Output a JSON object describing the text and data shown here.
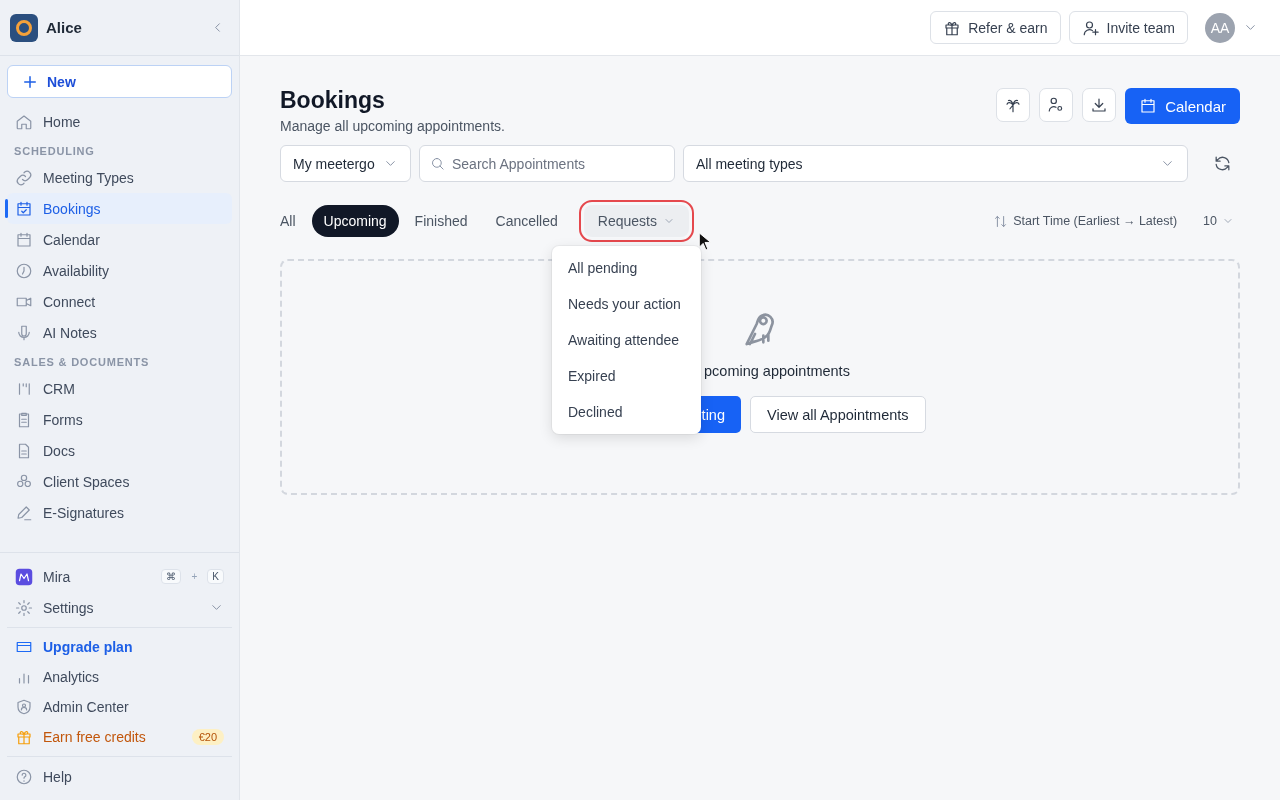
{
  "sidebar": {
    "workspace": "Alice",
    "new_button": "New",
    "sections": [
      {
        "items": [
          {
            "label": "Home",
            "selected": false
          }
        ]
      },
      {
        "title": "SCHEDULING",
        "items": [
          {
            "label": "Meeting Types",
            "selected": false
          },
          {
            "label": "Bookings",
            "selected": true
          },
          {
            "label": "Calendar",
            "selected": false
          },
          {
            "label": "Availability",
            "selected": false
          },
          {
            "label": "Connect",
            "selected": false
          },
          {
            "label": "AI Notes",
            "selected": false
          }
        ]
      },
      {
        "title": "SALES & DOCUMENTS",
        "items": [
          {
            "label": "CRM",
            "selected": false
          },
          {
            "label": "Forms",
            "selected": false
          },
          {
            "label": "Docs",
            "selected": false
          },
          {
            "label": "Client Spaces",
            "selected": false
          },
          {
            "label": "E-Signatures",
            "selected": false
          }
        ]
      }
    ],
    "assistant": {
      "label": "Mira",
      "shortcut": [
        "⌘",
        "+",
        "K"
      ]
    },
    "settings": {
      "label": "Settings",
      "expanded": false
    },
    "links": [
      {
        "label": "Upgrade plan",
        "kind": "upgrade"
      },
      {
        "label": "Analytics",
        "kind": "link"
      },
      {
        "label": "Admin Center",
        "kind": "link"
      },
      {
        "label": "Earn free credits",
        "kind": "promo",
        "badge": "€20"
      }
    ],
    "help": "Help"
  },
  "header": {
    "buttons": [
      "Refer & earn",
      "Invite team"
    ],
    "avatar": "AA"
  },
  "page": {
    "title": "Bookings",
    "subtitle": "Manage all upcoming appointments.",
    "primary_button": "Calendar"
  },
  "filters": {
    "owner": "My meetergo",
    "search": {
      "placeholder": "Search Appointments"
    },
    "meeting_type": "All meeting types"
  },
  "tabs": [
    {
      "label": "All",
      "selected": false,
      "kind": "tab"
    },
    {
      "label": "Upcoming",
      "selected": true,
      "kind": "tab"
    },
    {
      "label": "Finished",
      "selected": false,
      "kind": "tab"
    },
    {
      "label": "Cancelled",
      "selected": false,
      "kind": "tab"
    },
    {
      "label": "Requests",
      "selected": false,
      "kind": "dropdown",
      "expanded": true
    }
  ],
  "sort": {
    "label": "Start Time (Earliest → Latest)",
    "page_size": "10"
  },
  "requests_menu": [
    "All pending",
    "Needs your action",
    "Awaiting attendee",
    "Expired",
    "Declined"
  ],
  "empty_state": {
    "message": "pcoming appointments",
    "primary_button": "ting",
    "secondary_button": "View all Appointments"
  }
}
